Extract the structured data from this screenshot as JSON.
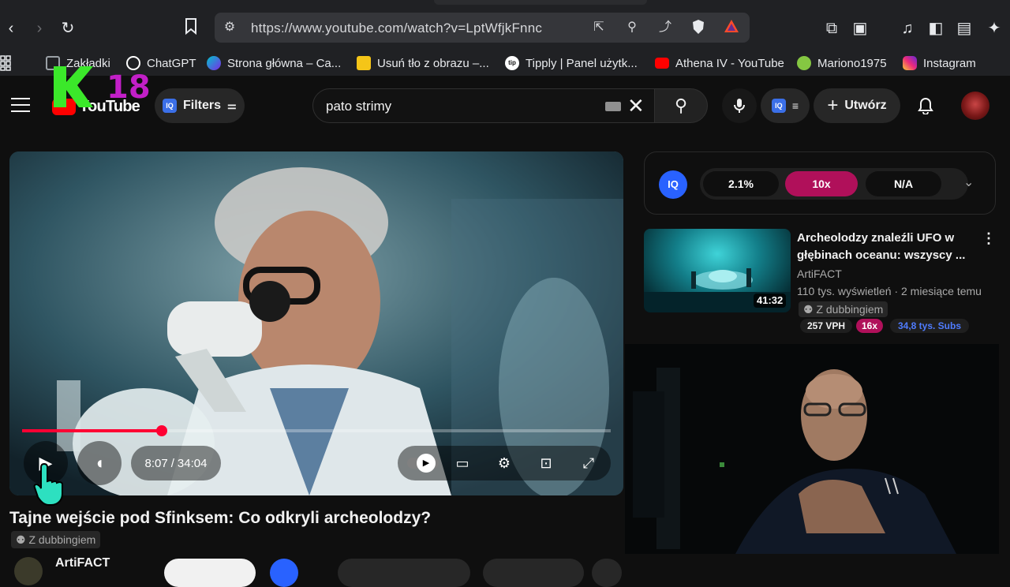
{
  "browser": {
    "url": "https://www.youtube.com/watch?v=LptWfjkFnnc",
    "bookmarks": [
      {
        "label": "Zakładki",
        "icon": "bookmark-icon",
        "color": "#9aa0a6"
      },
      {
        "label": "ChatGPT",
        "icon": "chatgpt-icon",
        "color": "#ffffff"
      },
      {
        "label": "Strona główna – Ca...",
        "icon": "canva-icon",
        "color": "#7d2ae8"
      },
      {
        "label": "Usuń tło z obrazu –...",
        "icon": "removebg-icon",
        "color": "#f5c518"
      },
      {
        "label": "Tipply | Panel użytk...",
        "icon": "tipply-icon",
        "color": "#111111"
      },
      {
        "label": "Athena IV - YouTube",
        "icon": "youtube-icon",
        "color": "#ff0000"
      },
      {
        "label": "Marionо1975",
        "icon": "rumble-icon",
        "color": "#85c742"
      },
      {
        "label": "Instagram",
        "icon": "instagram-icon",
        "color": "#e1306c"
      }
    ]
  },
  "overlay": {
    "k18_text": "18"
  },
  "header": {
    "logo_text": "YouTube",
    "filters_label": "Filters",
    "iq_label": "IQ",
    "search_value": "pato strimy",
    "create_label": "Utwórz"
  },
  "player": {
    "progress_fraction": 0.2369,
    "current_time": "8:07",
    "separator": "/",
    "duration": "34:04"
  },
  "video": {
    "title": "Tajne wejście pod Sfinksem: Co odkryli archeolodzy?",
    "dub_badge": "Z dubbingiem",
    "channel_name": "ArtiFACT"
  },
  "iq_panel": {
    "logo": "IQ",
    "metric_1": "2.1%",
    "metric_2": "10x",
    "metric_3": "N/A"
  },
  "recommended": {
    "title": "Archeolodzy znaleźli UFO w głębinach oceanu: wszyscy ...",
    "channel": "ArtiFACT",
    "meta": "110 tys. wyświetleń · 2 miesiące temu",
    "dub_badge": "Z dubbingiem",
    "duration": "41:32",
    "vph": "257 VPH",
    "multiplier": "16x",
    "subs": "34,8 tys. Subs"
  },
  "colors": {
    "accent_red": "#ff0033",
    "iq_blue": "#2962ff",
    "multiplier_magenta": "#b0105a"
  }
}
